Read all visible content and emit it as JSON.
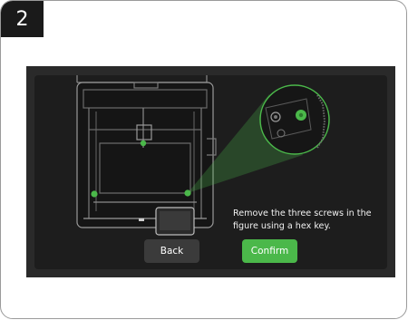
{
  "step": {
    "number": "2"
  },
  "instruction": {
    "text": "Remove the three screws in the figure using a hex key."
  },
  "buttons": {
    "back_label": "Back",
    "confirm_label": "Confirm"
  },
  "colors": {
    "accent": "#4bb84a",
    "screen_bg": "#1d1d1d",
    "badge_bg": "#1a1a1a"
  }
}
